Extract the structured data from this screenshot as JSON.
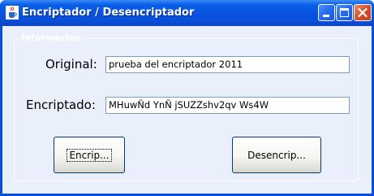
{
  "window": {
    "title": "Encriptador / Desencriptador",
    "icons": {
      "app": "java-cup-icon",
      "minimize": "minimize-icon",
      "maximize": "maximize-icon",
      "close": "close-icon"
    }
  },
  "group": {
    "label": "Información:"
  },
  "original": {
    "label": "Original:",
    "value": "prueba del encriptador 2011"
  },
  "encriptado": {
    "label": "Encriptado:",
    "value": "MHuwÑd YnÑ jSUZZshv2qv Ws4W"
  },
  "buttons": {
    "encrip": "Encrip...",
    "desencrip": "Desencrip..."
  },
  "colors": {
    "titlebar": "#0a4fd8",
    "window_bg": "#e9f0fb",
    "close_button": "#d5502c"
  }
}
